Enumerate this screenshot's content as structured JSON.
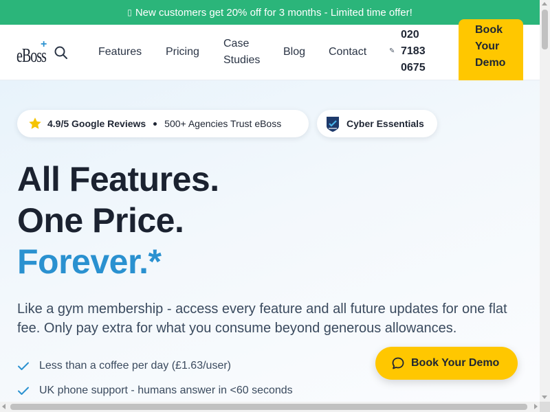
{
  "banner": {
    "icon": "gift-icon",
    "text": "New customers get 20% off for 3 months - Limited time offer!"
  },
  "header": {
    "logo_text": "eBoss",
    "logo_plus": "+",
    "nav": {
      "features": "Features",
      "pricing": "Pricing",
      "case_studies": "Case Studies",
      "blog": "Blog",
      "contact": "Contact"
    },
    "phone_icon": "✎",
    "phone": "020 7183 0675",
    "demo_button": "Book Your Demo"
  },
  "hero": {
    "reviews": {
      "rating": "4.9/5 Google Reviews",
      "trust": "500+ Agencies Trust eBoss"
    },
    "badge": "Cyber Essentials",
    "headline": {
      "line1": "All Features.",
      "line2": "One Price.",
      "line3": "Forever.*"
    },
    "subtitle": "Like a gym membership - access every feature and all future updates for one flat fee. Only pay extra for what you consume beyond generous allowances.",
    "bullets": [
      "Less than a coffee per day (£1.63/user)",
      "UK phone support - humans answer in <60 seconds"
    ]
  },
  "floating_button": "Book Your Demo",
  "colors": {
    "banner": "#2bb57a",
    "accent_yellow": "#ffc700",
    "brand_blue": "#2a91d0",
    "heading": "#1b2230"
  }
}
